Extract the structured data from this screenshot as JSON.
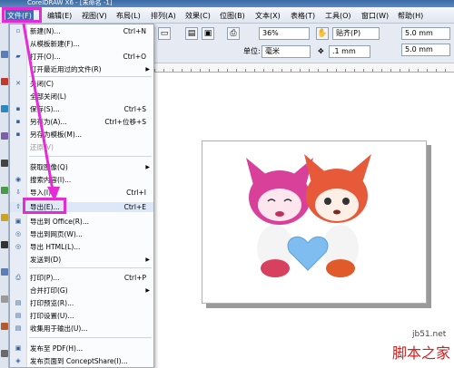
{
  "window": {
    "title": "CorelDRAW X6 - [未命名 -1]"
  },
  "menubar": [
    {
      "label": "文件(F)",
      "active": true
    },
    {
      "label": "编辑(E)"
    },
    {
      "label": "视图(V)"
    },
    {
      "label": "布局(L)"
    },
    {
      "label": "排列(A)"
    },
    {
      "label": "效果(C)"
    },
    {
      "label": "位图(B)"
    },
    {
      "label": "文本(X)"
    },
    {
      "label": "表格(T)"
    },
    {
      "label": "工具(O)"
    },
    {
      "label": "窗口(W)"
    },
    {
      "label": "帮助(H)"
    }
  ],
  "toolbar": {
    "zoom": "36%",
    "snap": "贴齐(P)",
    "unit_label": "单位:",
    "unit_value": "毫米",
    "nudge": ".1 mm",
    "dup_x": "5.0 mm",
    "dup_y": "5.0 mm"
  },
  "file_menu": [
    {
      "label": "新建(N)...",
      "shortcut": "Ctrl+N",
      "icon": "new-doc-icon"
    },
    {
      "label": "从模板新建(F)...",
      "shortcut": ""
    },
    {
      "label": "打开(O)...",
      "shortcut": "Ctrl+O",
      "icon": "open-folder-icon"
    },
    {
      "label": "打开最近用过的文件(R)",
      "submenu": true
    },
    {
      "sep": true
    },
    {
      "label": "关闭(C)",
      "icon": "close-doc-icon"
    },
    {
      "label": "全部关闭(L)"
    },
    {
      "label": "保存(S)...",
      "shortcut": "Ctrl+S",
      "icon": "save-icon"
    },
    {
      "label": "另存为(A)...",
      "shortcut": "Ctrl+位移+S",
      "icon": "save-as-icon"
    },
    {
      "label": "另存为模板(M)...",
      "icon": "template-icon"
    },
    {
      "label": "还原(V)",
      "disabled": true
    },
    {
      "sep": true
    },
    {
      "label": "获取图像(Q)",
      "submenu": true
    },
    {
      "label": "搜索内容(I)...",
      "icon": "search-icon"
    },
    {
      "label": "导入(I)...",
      "shortcut": "Ctrl+I",
      "icon": "import-icon"
    },
    {
      "label": "导出(E)...",
      "shortcut": "Ctrl+E",
      "icon": "export-icon",
      "highlight": true
    },
    {
      "label": "导出到 Office(R)...",
      "icon": "office-icon"
    },
    {
      "label": "导出到网页(W)...",
      "icon": "web-icon"
    },
    {
      "label": "导出 HTML(L)...",
      "icon": "html-icon"
    },
    {
      "label": "发送到(D)",
      "submenu": true
    },
    {
      "sep": true
    },
    {
      "label": "打印(P)...",
      "shortcut": "Ctrl+P",
      "icon": "print-icon"
    },
    {
      "label": "合并打印(G)",
      "submenu": true
    },
    {
      "label": "打印预览(R)...",
      "icon": "preview-icon"
    },
    {
      "label": "打印设置(U)...",
      "icon": "print-setup-icon"
    },
    {
      "label": "收集用于输出(U)...",
      "icon": "collect-icon"
    },
    {
      "sep": true
    },
    {
      "label": "发布至 PDF(H)...",
      "icon": "pdf-icon"
    },
    {
      "label": "发布页面到 ConceptShare(I)...",
      "icon": "share-icon"
    }
  ],
  "watermark": {
    "url": "jb51.net",
    "text": "脚本之家"
  },
  "colors": {
    "highlight": "#e52ad6",
    "menu_active": "#3d6fb0"
  }
}
